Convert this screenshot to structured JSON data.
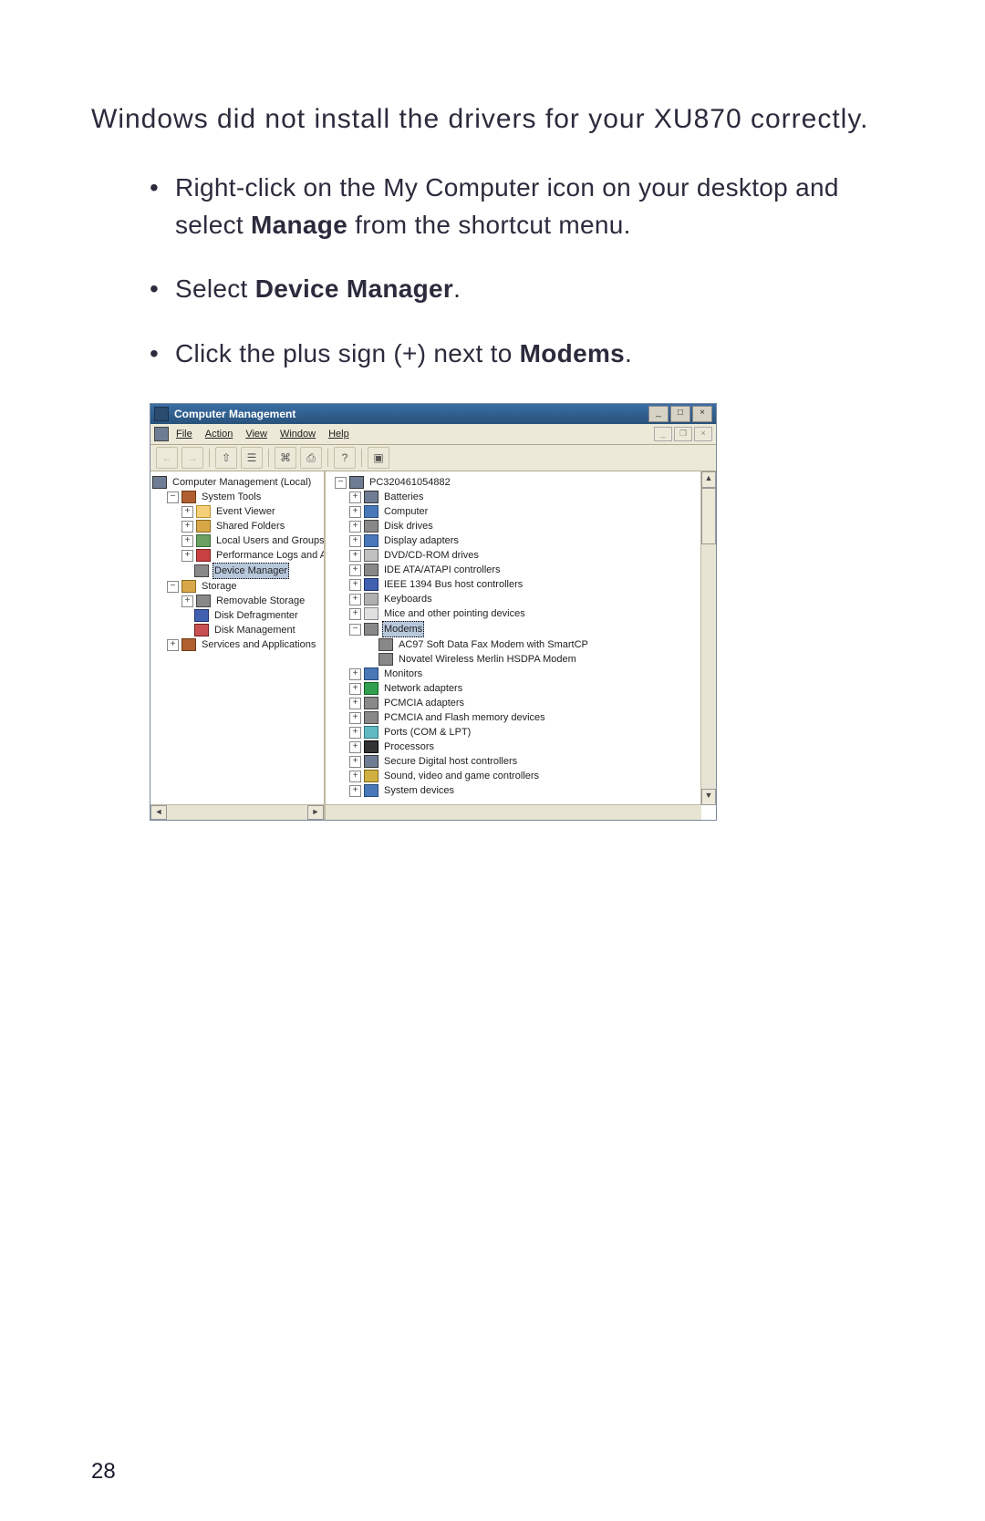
{
  "heading": "Windows did not install the drivers for your XU870 correctly.",
  "bullets": {
    "b1_a": "Right-click on the My Computer icon on your desktop and select ",
    "b1_b": "Manage",
    "b1_c": " from the shortcut menu.",
    "b2_a": "Select ",
    "b2_b": "Device Manager",
    "b2_c": ".",
    "b3_a": "Click the plus sign (+) next to ",
    "b3_b": "Modems",
    "b3_c": "."
  },
  "window": {
    "title": "Computer Management",
    "min": "_",
    "max": "□",
    "close": "×",
    "menu": {
      "file": "File",
      "action": "Action",
      "view": "View",
      "window": "Window",
      "help": "Help"
    },
    "doc": {
      "min": "_",
      "restore": "❐",
      "close": "×"
    },
    "toolbar": {
      "back": "←",
      "fwd": "→",
      "up": "⇧",
      "list": "☰",
      "prop": "⌘",
      "print": "⎙",
      "help": "?",
      "show": "▣"
    }
  },
  "left_tree": {
    "root": "Computer Management (Local)",
    "system_tools": "System Tools",
    "event_viewer": "Event Viewer",
    "shared_folders": "Shared Folders",
    "local_users": "Local Users and Groups",
    "perf": "Performance Logs and Alerts",
    "device_manager": "Device Manager",
    "storage": "Storage",
    "removable": "Removable Storage",
    "defrag": "Disk Defragmenter",
    "diskmgmt": "Disk Management",
    "services": "Services and Applications"
  },
  "right_tree": {
    "root": "PC320461054882",
    "batteries": "Batteries",
    "computer": "Computer",
    "disk_drives": "Disk drives",
    "display": "Display adapters",
    "dvd": "DVD/CD-ROM drives",
    "ide": "IDE ATA/ATAPI controllers",
    "ieee": "IEEE 1394 Bus host controllers",
    "keyboards": "Keyboards",
    "mice": "Mice and other pointing devices",
    "modems": "Modems",
    "modem1": "AC97 Soft Data Fax Modem with SmartCP",
    "modem2": "Novatel Wireless Merlin HSDPA Modem",
    "monitors": "Monitors",
    "network": "Network adapters",
    "pcmcia": "PCMCIA adapters",
    "pcmcia_flash": "PCMCIA and Flash memory devices",
    "ports": "Ports (COM & LPT)",
    "processors": "Processors",
    "sd": "Secure Digital host controllers",
    "sound": "Sound, video and game controllers",
    "system": "System devices"
  },
  "scroll": {
    "left": "◄",
    "right": "►",
    "up": "▲",
    "down": "▼"
  },
  "page_number": "28"
}
